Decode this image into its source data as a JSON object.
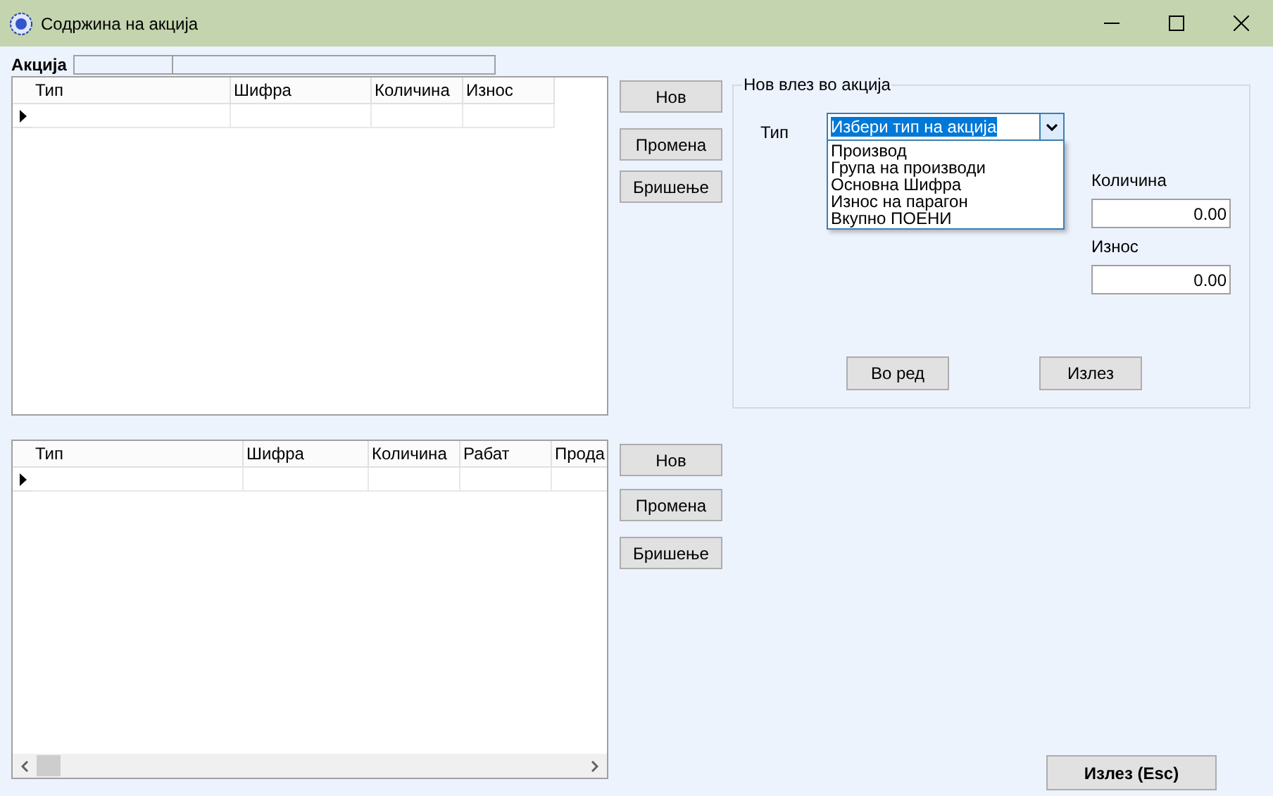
{
  "window": {
    "title": "Содржина на акција"
  },
  "action": {
    "label": "Акција"
  },
  "grids": [
    {
      "columns": [
        {
          "label": "Тип"
        },
        {
          "label": "Шифра"
        },
        {
          "label": "Количина"
        },
        {
          "label": "Износ"
        }
      ],
      "hscroll": false,
      "buttons": [
        "Нов",
        "Промена",
        "Бришење"
      ]
    },
    {
      "columns": [
        {
          "label": "Тип"
        },
        {
          "label": "Шифра"
        },
        {
          "label": "Количина"
        },
        {
          "label": "Рабат"
        },
        {
          "label": "Прода"
        }
      ],
      "hscroll": true,
      "buttons": [
        "Нов",
        "Промена",
        "Бришење"
      ]
    }
  ],
  "entry_group": {
    "title": "Нов влез во акција",
    "type_label": "Тип",
    "type_combo": {
      "value": "Избери тип на акција",
      "expanded": true,
      "options": [
        {
          "label": "Производ",
          "selected": false
        },
        {
          "label": "Група на производи",
          "selected": false
        },
        {
          "label": "Основна Шифра",
          "selected": false
        },
        {
          "label": "Износ на парагон",
          "selected": false
        },
        {
          "label": "Вкупно ПОЕНИ",
          "selected": false
        }
      ]
    },
    "fields": [
      {
        "label": "Количина",
        "value": "0.00"
      },
      {
        "label": "Износ",
        "value": "0.00"
      }
    ],
    "buttons": [
      "Во ред",
      "Излез"
    ]
  },
  "exit_button": "Излез (Esc)"
}
